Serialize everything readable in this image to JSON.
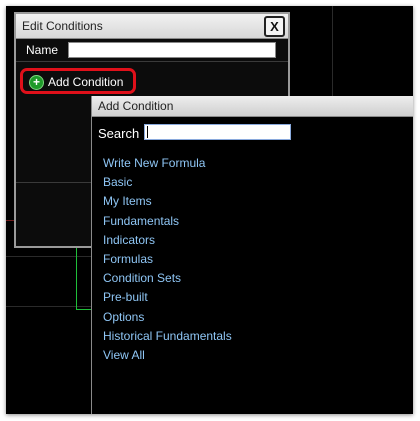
{
  "edit_conditions": {
    "title": "Edit Conditions",
    "close_label": "X",
    "name_label": "Name",
    "name_value": "",
    "add_condition_label": "Add Condition",
    "highlight_color": "#e0101a"
  },
  "add_condition": {
    "title": "Add Condition",
    "search_label": "Search",
    "search_value": "",
    "items": [
      "Write New Formula",
      "Basic",
      "My Items",
      "Fundamentals",
      "Indicators",
      "Formulas",
      "Condition Sets",
      "Pre-built",
      "Options",
      "Historical Fundamentals",
      "View All"
    ],
    "link_color": "#8fc6f5"
  }
}
